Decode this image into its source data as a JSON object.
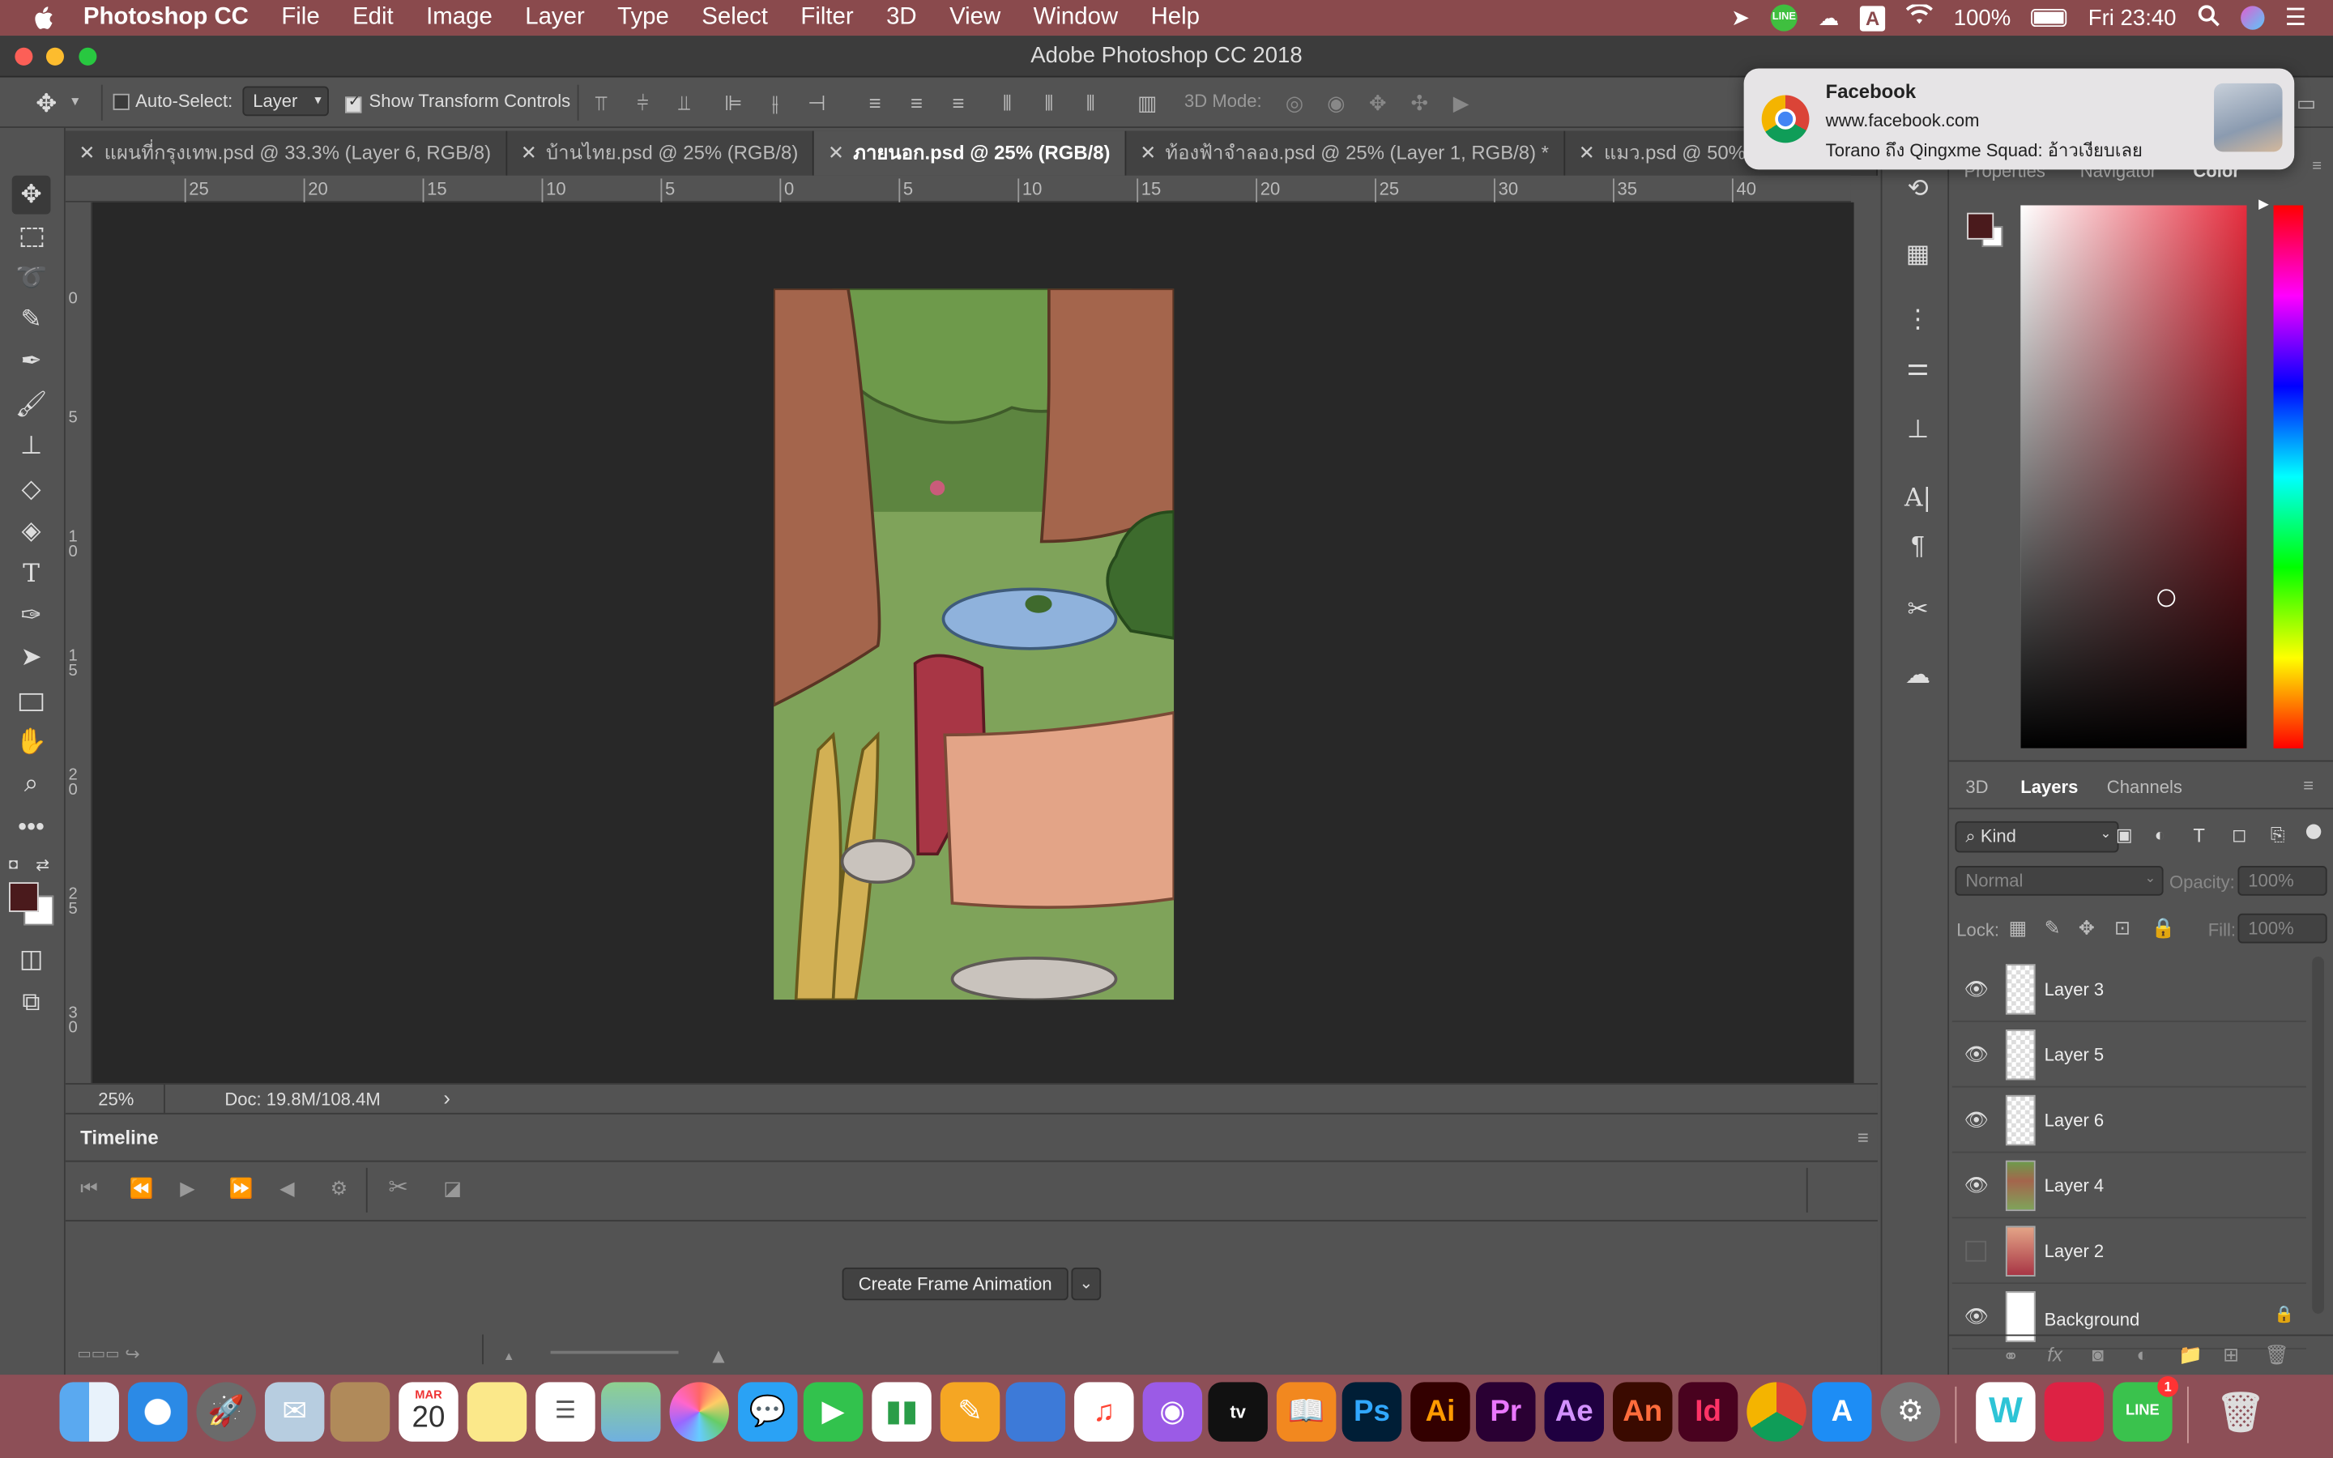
{
  "menubar": {
    "apple": "",
    "app_name": "Photoshop CC",
    "menus": [
      "File",
      "Edit",
      "Image",
      "Layer",
      "Type",
      "Select",
      "Filter",
      "3D",
      "View",
      "Window",
      "Help"
    ],
    "battery": "100%",
    "clock": "Fri 23:40",
    "input_indicator": "A"
  },
  "window": {
    "title": "Adobe Photoshop CC 2018"
  },
  "options_bar": {
    "auto_select_label": "Auto-Select:",
    "auto_select_value": "Layer",
    "show_transform_label": "Show Transform Controls",
    "mode_3d_label": "3D Mode:"
  },
  "tabs": [
    {
      "label": "แผนที่กรุงเทพ.psd @ 33.3% (Layer 6, RGB/8)"
    },
    {
      "label": "บ้านไทย.psd @ 25% (RGB/8)"
    },
    {
      "label": "ภายนอก.psd @ 25% (RGB/8)"
    },
    {
      "label": "ท้องฟ้าจำลอง.psd @ 25% (Layer 1, RGB/8) *"
    },
    {
      "label": "แมว.psd @ 50% (RGB"
    }
  ],
  "ruler": {
    "h_ticks": [
      "25",
      "20",
      "15",
      "10",
      "5",
      "0",
      "5",
      "10",
      "15",
      "20",
      "25",
      "30",
      "35",
      "40"
    ],
    "v_ticks": [
      "0",
      "5",
      "1\n0",
      "1\n5",
      "2\n0",
      "2\n5",
      "3\n0"
    ]
  },
  "status": {
    "zoom": "25%",
    "doc": "Doc: 19.8M/108.4M",
    "arrow": "›"
  },
  "timeline": {
    "title": "Timeline",
    "create_button": "Create Frame Animation"
  },
  "color_panel": {
    "tabs": [
      "Properties",
      "Navigator",
      "Color"
    ],
    "foreground": "#4a1a1c",
    "background": "#ffffff"
  },
  "layers_panel": {
    "tabs": [
      "3D",
      "Layers",
      "Channels"
    ],
    "filter_kind": "Kind",
    "blend_mode": "Normal",
    "opacity_label": "Opacity:",
    "opacity_value": "100%",
    "lock_label": "Lock:",
    "fill_label": "Fill:",
    "fill_value": "100%",
    "layers": [
      {
        "name": "Layer 3",
        "visible": true
      },
      {
        "name": "Layer 5",
        "visible": true
      },
      {
        "name": "Layer 6",
        "visible": true
      },
      {
        "name": "Layer 4",
        "visible": true
      },
      {
        "name": "Layer 2",
        "visible": false
      },
      {
        "name": "Background",
        "visible": true
      }
    ]
  },
  "notification": {
    "app": "Facebook",
    "site": "www.facebook.com",
    "message": "Torano ถึง Qingxme Squad: อ้าวเงียบเลย"
  },
  "dock": {
    "calendar_month": "MAR",
    "calendar_day": "20",
    "tv_label": "tv",
    "ps": "Ps",
    "ai": "Ai",
    "pr": "Pr",
    "ae": "Ae",
    "an": "An",
    "id": "Id",
    "line_badge": "1",
    "line_label": "LINE"
  },
  "colors": {
    "menubar": "#8a4a4d",
    "panel": "#535353",
    "canvas_bg": "#282828",
    "dock": "#8d4f57"
  }
}
